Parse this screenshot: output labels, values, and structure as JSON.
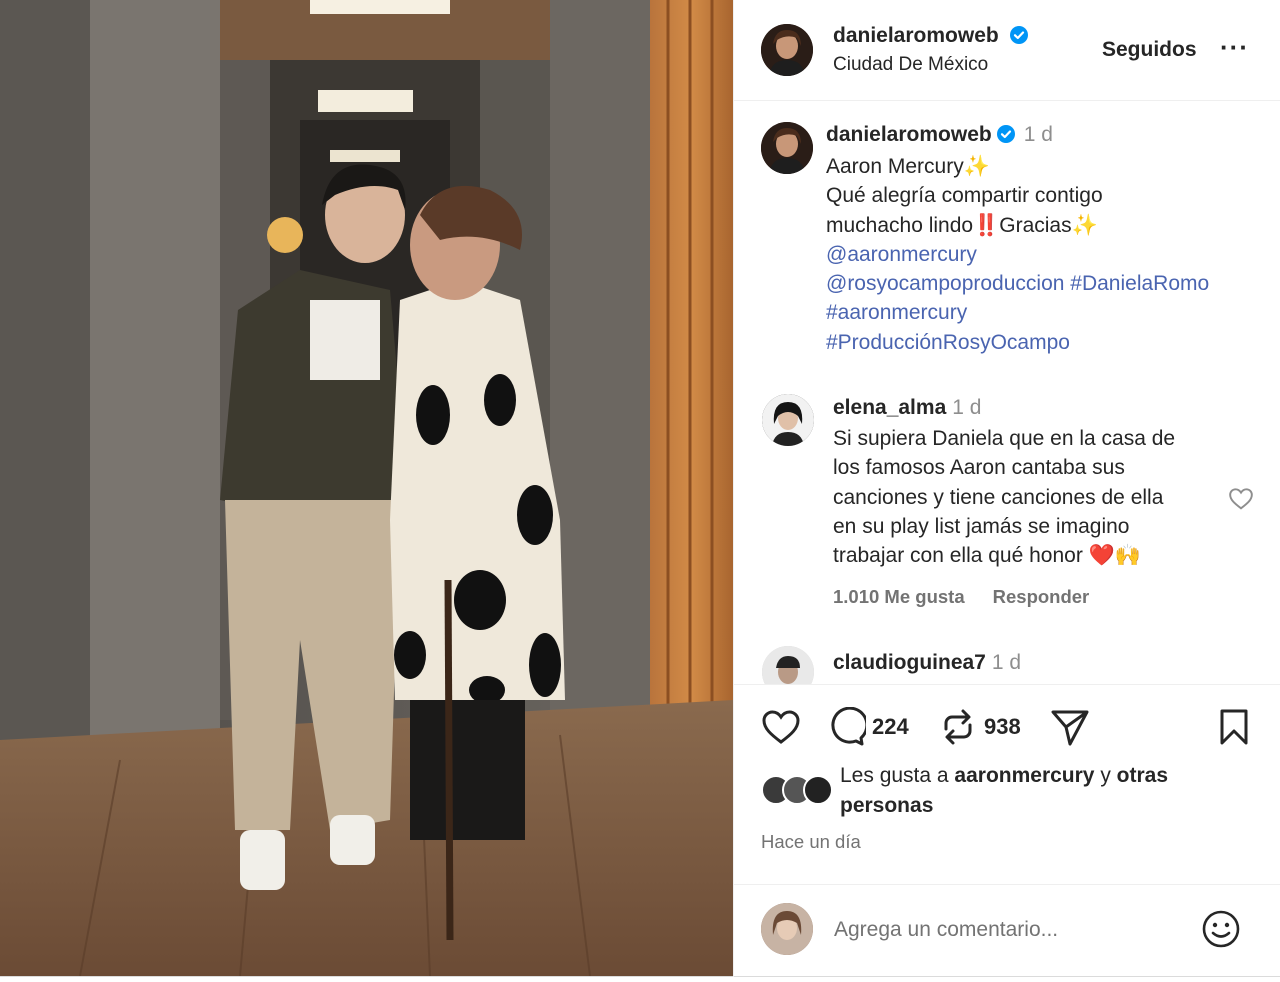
{
  "post": {
    "username": "danielaromoweb",
    "location": "Ciudad De México",
    "follow_label": "Seguidos",
    "more_label": "···"
  },
  "caption": {
    "username": "danielaromoweb",
    "time": "1 d",
    "line1": "Aaron Mercury",
    "line1_emoji": "✨",
    "line2": "Qué alegría compartir contigo",
    "line3a": "muchacho lindo",
    "line3_emoji1": "‼️",
    "line3b": "Gracias",
    "line3_emoji2": "✨",
    "mention1": "@aaronmercury",
    "mention2": "@rosyocampoproduccion",
    "tag1": "#DanielaRomo",
    "tag2": "#aaronmercury",
    "tag3": "#ProducciónRosyOcampo"
  },
  "comment1": {
    "username": "elena_alma",
    "time": "1 d",
    "line1": "Si supiera Daniela que en la casa de",
    "line2": "los famosos Aaron cantaba sus",
    "line3": "canciones y tiene canciones de ella",
    "line4": "en su play list jamás se imagino",
    "line5": "trabajar con ella qué honor ❤️🙌",
    "likes": "1.010 Me gusta",
    "reply": "Responder"
  },
  "comment2": {
    "username": "claudioguinea7",
    "time": "1 d"
  },
  "actions": {
    "like_icon": "heart-icon",
    "comment_icon": "comment-icon",
    "comment_count": "224",
    "repost_icon": "repost-icon",
    "repost_count": "938",
    "share_icon": "share-icon",
    "save_icon": "bookmark-icon"
  },
  "likes": {
    "prefix": "Les gusta a ",
    "user": "aaronmercury",
    "middle": " y ",
    "suffix": "otras personas"
  },
  "posted_ago": "Hace un día",
  "add_comment": {
    "placeholder": "Agrega un comentario..."
  },
  "colors": {
    "link": "#4a64b0",
    "verified": "#0095f6",
    "muted": "#737373"
  }
}
